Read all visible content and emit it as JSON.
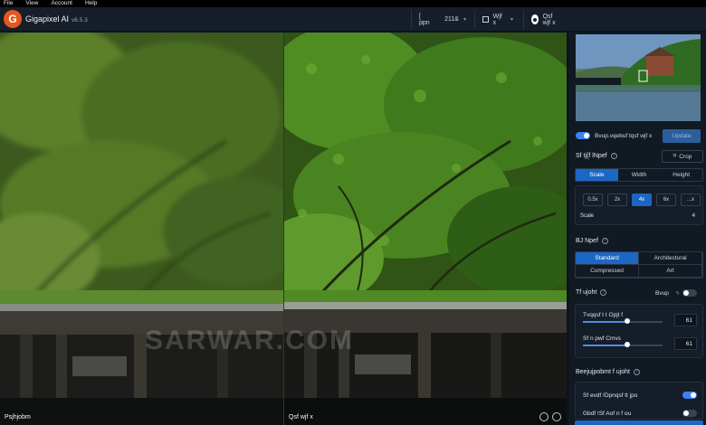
{
  "menu": [
    "File",
    "View",
    "Account",
    "Help"
  ],
  "app": {
    "name": "Gigapixel AI",
    "version": "v6.5.3"
  },
  "toolbar": {
    "zoom_label": "[ ppn",
    "zoom_value": "211&",
    "view_label": "Wjf x",
    "preview_label": "Qsf wjf x"
  },
  "panes": {
    "left_label": "Psjhjobm",
    "right_label": "Qsf wjf x",
    "watermark": "SARWAR.COM"
  },
  "panel": {
    "toggle_label": "Bvup.vqebuf tqsf wjf x",
    "update_button": "Update",
    "size_title": "Sf tj{f lNpef",
    "crop_button": "Crop",
    "size_tabs": [
      "Scale",
      "Width",
      "Height"
    ],
    "scale_options": [
      "0.5x",
      "2x",
      "4x",
      "6x",
      "...x"
    ],
    "scale_label": "Scale",
    "scale_value": "4",
    "model_title": "BJ Npef",
    "models": [
      "Standard",
      "Architectural",
      "Compressed",
      "Art"
    ],
    "settings_title": "Tf ujoht",
    "auto_label": "Bvup",
    "slider1_label": "Tvqqsf t t Opjt f",
    "slider1_value": "61",
    "slider2_label": "Sf n pwf Cmvs",
    "slider2_value": "61",
    "enhance_title": "Beejujpobmt f ujoht",
    "face_label": "Sf evdf !Dpnqsf tt jpo",
    "gamma_label": "Gbdf !Sf Aof n f ou"
  },
  "colors": {
    "accent": "#1c67c4",
    "logo": "#e4571f"
  }
}
